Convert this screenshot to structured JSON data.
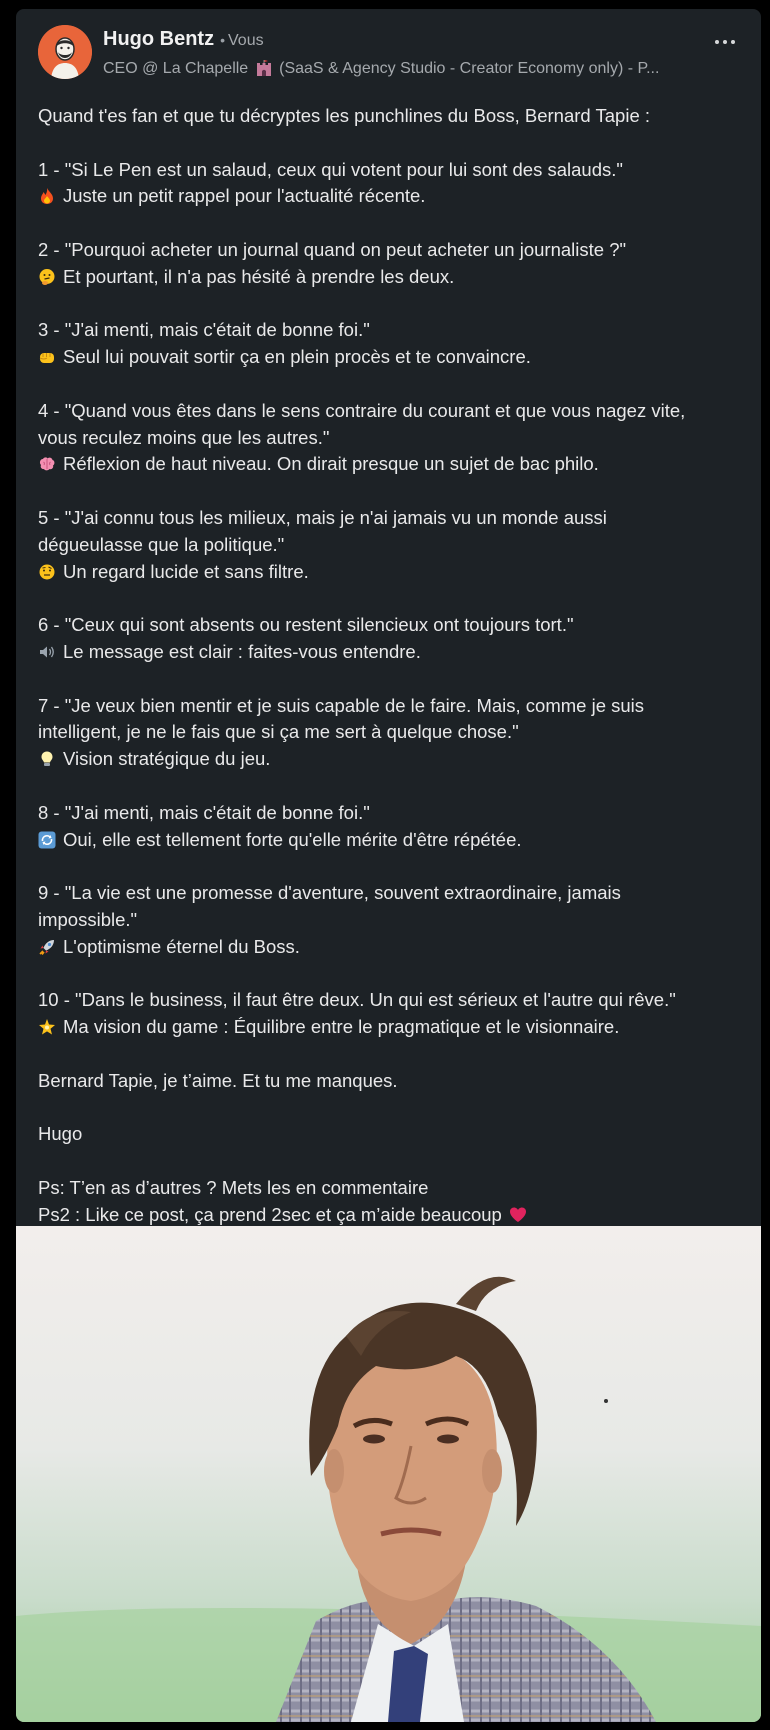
{
  "post": {
    "author": {
      "name": "Hugo Bentz",
      "separator": "•",
      "badge": "Vous",
      "headline_prefix": "CEO @ La Chapelle",
      "headline_suffix": "(SaaS & Agency Studio - Creator Economy only) - P..."
    },
    "intro": "Quand t'es fan et que tu décryptes les punchlines du Boss, Bernard Tapie :",
    "quotes": [
      {
        "lines": [
          "1 - \"Si Le Pen est un salaud, ceux qui votent pour lui sont des salauds.\""
        ],
        "emoji": "fire-icon",
        "comment": "Juste un petit rappel pour l'actualité récente."
      },
      {
        "lines": [
          "2 - \"Pourquoi acheter un journal quand on peut acheter un journaliste ?\""
        ],
        "emoji": "thinking-face-icon",
        "comment": "Et pourtant, il n'a pas hésité à prendre les deux."
      },
      {
        "lines": [
          "3 - \"J'ai menti, mais c'était de bonne foi.\""
        ],
        "emoji": "fist-icon",
        "comment": "Seul lui pouvait sortir ça en plein procès et te convaincre."
      },
      {
        "lines": [
          "4 - \"Quand vous êtes dans le sens contraire du courant et que vous nagez vite,",
          "vous reculez moins que les autres.\""
        ],
        "emoji": "brain-icon",
        "comment": "Réflexion de haut niveau. On dirait presque un sujet de bac philo."
      },
      {
        "lines": [
          "5 - \"J'ai connu tous les milieux, mais je n'ai jamais vu un monde aussi",
          "dégueulasse que la politique.\""
        ],
        "emoji": "raised-eyebrow-face-icon",
        "comment": "Un regard lucide et sans filtre."
      },
      {
        "lines": [
          "6 - \"Ceux qui sont absents ou restent silencieux ont toujours tort.\""
        ],
        "emoji": "speaker-icon",
        "comment": "Le message est clair : faites-vous entendre."
      },
      {
        "lines": [
          "7 - \"Je veux bien mentir et je suis capable de le faire. Mais, comme je suis",
          "intelligent, je ne le fais que si ça me sert à quelque chose.\""
        ],
        "emoji": "lightbulb-icon",
        "comment": "Vision stratégique du jeu."
      },
      {
        "lines": [
          "8 - \"J'ai menti, mais c'était de bonne foi.\""
        ],
        "emoji": "repeat-arrows-icon",
        "comment": "Oui, elle est tellement forte qu'elle mérite d'être répétée."
      },
      {
        "lines": [
          "9 - \"La vie est une promesse d'aventure, souvent extraordinaire, jamais",
          "impossible.\""
        ],
        "emoji": "rocket-icon",
        "comment": "L'optimisme éternel du Boss."
      },
      {
        "lines": [
          "10 - \"Dans le business, il faut être deux. Un qui est sérieux et l'autre qui rêve.\""
        ],
        "emoji": "glowing-star-icon",
        "comment": "Ma vision du game : Équilibre entre le pragmatique et le visionnaire."
      }
    ],
    "closing": "Bernard Tapie, je t’aime. Et tu me manques.",
    "signature": "Hugo",
    "ps1": "Ps: T’en as d’autres ? Mets les en commentaire",
    "ps2": "Ps2 : Like ce post, ça prend 2sec et ça m’aide beaucoup",
    "ps2_emoji": "red-heart-icon"
  },
  "colors": {
    "card_bg": "#1d2226",
    "text": "#e9e9ea",
    "muted": "#a5a9ad",
    "avatar_bg": "#e8653a"
  }
}
